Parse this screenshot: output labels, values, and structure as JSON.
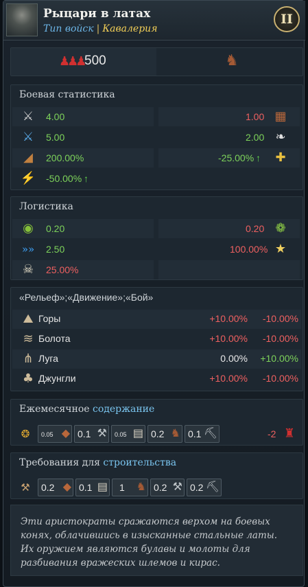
{
  "header": {
    "title": "Рыцари в латах",
    "type_label": "Тип войск",
    "type_value": "Кавалерия",
    "level_roman": "II"
  },
  "size": {
    "value": "500"
  },
  "combat": {
    "heading": "Боевая статистика",
    "left": [
      {
        "icon": "melee-attack-icon",
        "value": "4.00",
        "color": "green"
      },
      {
        "icon": "charge-attack-icon",
        "value": "5.00",
        "color": "green"
      },
      {
        "icon": "morale-damage-icon",
        "value": "200.00%",
        "color": "green"
      },
      {
        "icon": "lightning-bonus-icon",
        "value": "-50.00%",
        "color": "green",
        "arrow": "↑"
      }
    ],
    "right": [
      {
        "icon": "defense-wall-icon",
        "value": "1.00",
        "color": "red"
      },
      {
        "icon": "wing-icon",
        "value": "2.00",
        "color": "green"
      },
      {
        "icon": "casualty-icon",
        "value": "-25.00%",
        "color": "green",
        "arrow": "↑"
      }
    ]
  },
  "logistics": {
    "heading": "Логистика",
    "left": [
      {
        "icon": "supply-sack-icon",
        "value": "0.20",
        "color": "green"
      },
      {
        "icon": "speed-chevrons-icon",
        "value": "2.50",
        "color": "green"
      },
      {
        "icon": "skull-icon",
        "value": "25.00%",
        "color": "red"
      }
    ],
    "right": [
      {
        "icon": "forage-icon",
        "value": "0.20",
        "color": "red"
      },
      {
        "icon": "star-bomb-icon",
        "value": "100.00%",
        "color": "red"
      }
    ]
  },
  "terrain": {
    "heading": "«Рельеф»;«Движение»;«Бой»",
    "rows": [
      {
        "icon": "mountains-icon",
        "label": "Горы",
        "v1": "+10.00%",
        "v1c": "red",
        "v2": "-10.00%",
        "v2c": "red"
      },
      {
        "icon": "marsh-icon",
        "label": "Болота",
        "v1": "+10.00%",
        "v1c": "red",
        "v2": "-10.00%",
        "v2c": "red"
      },
      {
        "icon": "grass-icon",
        "label": "Луга",
        "v1": "0.00%",
        "v1c": "white",
        "v2": "+10.00%",
        "v2c": "green"
      },
      {
        "icon": "jungle-icon",
        "label": "Джунгли",
        "v1": "+10.00%",
        "v1c": "red",
        "v2": "-10.00%",
        "v2c": "red"
      }
    ]
  },
  "upkeep": {
    "heading_plain": "Ежемесячное ",
    "heading_highlight": "содержание",
    "items": [
      {
        "value": "0.05",
        "icon": "leather-icon"
      },
      {
        "value": "0.1",
        "icon": "tools-icon"
      },
      {
        "value": "0.05",
        "icon": "cloth-icon"
      },
      {
        "value": "0.2",
        "icon": "horse-icon"
      },
      {
        "value": "0.1",
        "icon": "pickaxe-icon"
      }
    ],
    "manpower": "-2"
  },
  "build": {
    "heading_plain": "Требования для ",
    "heading_highlight": "строительства",
    "items": [
      {
        "value": "0.2",
        "icon": "leather-icon"
      },
      {
        "value": "0.1",
        "icon": "cloth-icon"
      },
      {
        "value": "1",
        "icon": "horse-icon"
      },
      {
        "value": "0.2",
        "icon": "tools-icon"
      },
      {
        "value": "0.2",
        "icon": "pickaxe-icon"
      }
    ]
  },
  "description": "Эти аристократы сражаются верхом на боевых конях, облачившись в изысканные стальные латы. Их оружием являются булавы и молоты для разбивания вражеских шлемов и кирас."
}
